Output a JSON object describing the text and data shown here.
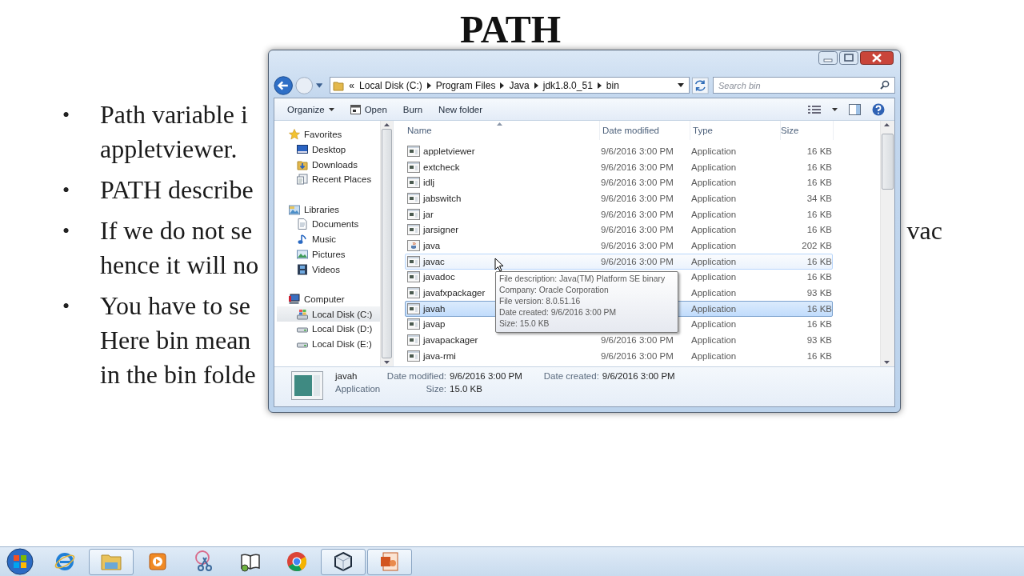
{
  "slide": {
    "title": "PATH",
    "bullets": [
      {
        "marker": "•",
        "lines": [
          {
            "text": "Path variable i"
          },
          {
            "text": "appletviewer."
          }
        ]
      },
      {
        "marker": "•",
        "lines": [
          {
            "text": "PATH describe"
          }
        ]
      },
      {
        "marker": "•",
        "lines": [
          {
            "text": "If we do not se",
            "right": "vac"
          },
          {
            "text": "hence it will no"
          }
        ]
      },
      {
        "marker": "•",
        "lines": [
          {
            "text": "You have to se"
          },
          {
            "text": "Here bin mean"
          },
          {
            "text": "in the bin folde"
          }
        ]
      }
    ]
  },
  "explorer": {
    "address": {
      "prefix": "«",
      "segments": [
        "Local Disk (C:)",
        "Program Files",
        "Java",
        "jdk1.8.0_51",
        "bin"
      ]
    },
    "search": {
      "placeholder": "Search bin"
    },
    "toolbar": [
      {
        "label": "Organize",
        "kind": "menu"
      },
      {
        "label": "Open",
        "kind": "icon"
      },
      {
        "label": "Burn",
        "kind": "plain"
      },
      {
        "label": "New folder",
        "kind": "plain"
      }
    ],
    "nav_pane": [
      {
        "label": "Favorites",
        "selected": false,
        "children": [
          {
            "label": "Desktop",
            "selected": false
          },
          {
            "label": "Downloads",
            "selected": false
          },
          {
            "label": "Recent Places",
            "selected": false
          }
        ]
      },
      {
        "label": "Libraries",
        "selected": false,
        "children": [
          {
            "label": "Documents",
            "selected": false
          },
          {
            "label": "Music",
            "selected": false
          },
          {
            "label": "Pictures",
            "selected": false
          },
          {
            "label": "Videos",
            "selected": false
          }
        ]
      },
      {
        "label": "Computer",
        "selected": false,
        "children": [
          {
            "label": "Local Disk (C:)",
            "selected": true
          },
          {
            "label": "Local Disk (D:)",
            "selected": false
          },
          {
            "label": "Local Disk (E:)",
            "selected": false
          }
        ]
      }
    ],
    "columns": [
      "Name",
      "Date modified",
      "Type",
      "Size"
    ],
    "rows": [
      {
        "name": "appletviewer",
        "kind": "console",
        "date": "9/6/2016 3:00 PM",
        "type": "Application",
        "size": "16 KB",
        "selected": false,
        "hovered": false
      },
      {
        "name": "extcheck",
        "kind": "console",
        "date": "9/6/2016 3:00 PM",
        "type": "Application",
        "size": "16 KB",
        "selected": false,
        "hovered": false
      },
      {
        "name": "idlj",
        "kind": "console",
        "date": "9/6/2016 3:00 PM",
        "type": "Application",
        "size": "16 KB",
        "selected": false,
        "hovered": false
      },
      {
        "name": "jabswitch",
        "kind": "console",
        "date": "9/6/2016 3:00 PM",
        "type": "Application",
        "size": "34 KB",
        "selected": false,
        "hovered": false
      },
      {
        "name": "jar",
        "kind": "console",
        "date": "9/6/2016 3:00 PM",
        "type": "Application",
        "size": "16 KB",
        "selected": false,
        "hovered": false
      },
      {
        "name": "jarsigner",
        "kind": "console",
        "date": "9/6/2016 3:00 PM",
        "type": "Application",
        "size": "16 KB",
        "selected": false,
        "hovered": false
      },
      {
        "name": "java",
        "kind": "launcher",
        "date": "9/6/2016 3:00 PM",
        "type": "Application",
        "size": "202 KB",
        "selected": false,
        "hovered": false
      },
      {
        "name": "javac",
        "kind": "console",
        "date": "9/6/2016 3:00 PM",
        "type": "Application",
        "size": "16 KB",
        "selected": false,
        "hovered": true
      },
      {
        "name": "javadoc",
        "kind": "console",
        "type": "Application",
        "size": "16 KB",
        "selected": false,
        "hovered": false
      },
      {
        "name": "javafxpackager",
        "kind": "console",
        "type": "Application",
        "size": "93 KB",
        "selected": false,
        "hovered": false
      },
      {
        "name": "javah",
        "kind": "console",
        "type": "Application",
        "size": "16 KB",
        "selected": true,
        "hovered": false
      },
      {
        "name": "javap",
        "kind": "console",
        "type": "Application",
        "size": "16 KB",
        "selected": false,
        "hovered": false
      },
      {
        "name": "javapackager",
        "kind": "console",
        "date": "9/6/2016 3:00 PM",
        "type": "Application",
        "size": "93 KB",
        "selected": false,
        "hovered": false
      },
      {
        "name": "java-rmi",
        "kind": "console",
        "date": "9/6/2016 3:00 PM",
        "type": "Application",
        "size": "16 KB",
        "selected": false,
        "hovered": false
      }
    ],
    "tooltip": [
      "File description: Java(TM) Platform SE binary",
      "Company: Oracle Corporation",
      "File version: 8.0.51.16",
      "Date created: 9/6/2016 3:00 PM",
      "Size: 15.0 KB"
    ],
    "details": {
      "name": "javah",
      "type": "Application",
      "fields": [
        {
          "label": "Date modified:",
          "value": "9/6/2016 3:00 PM"
        },
        {
          "label": "Date created:",
          "value": "9/6/2016 3:00 PM"
        },
        {
          "label": "Size:",
          "value": "15.0 KB"
        }
      ]
    }
  },
  "taskbar": {
    "items": [
      {
        "open": false
      },
      {
        "open": true
      },
      {
        "open": false
      },
      {
        "open": false
      },
      {
        "open": false
      },
      {
        "open": false
      },
      {
        "open": true
      },
      {
        "open": true
      }
    ]
  }
}
